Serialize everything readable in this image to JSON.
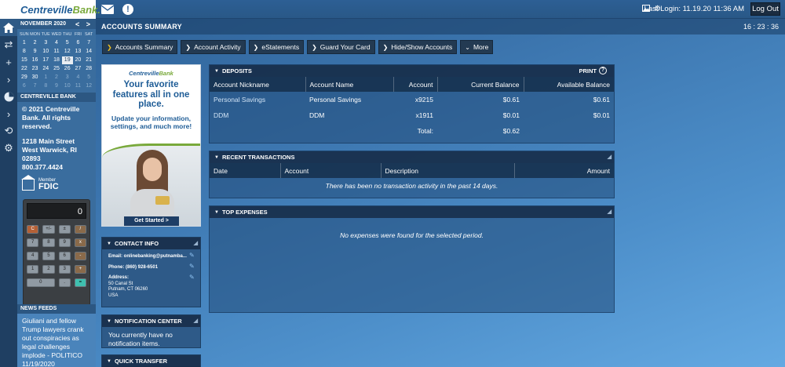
{
  "brand": {
    "name_main": "Centreville",
    "name_accent": "Bank."
  },
  "header": {
    "last_login": "Last Login: 11.19.20 11:36 AM",
    "logout_label": "Log Out",
    "page_title": "ACCOUNTS SUMMARY",
    "clock": "16 : 23 : 36"
  },
  "calendar": {
    "month": "November 2020",
    "arrows": "< >",
    "dow": [
      "SUN",
      "MON",
      "TUE",
      "WED",
      "THU",
      "FRI",
      "SAT"
    ],
    "weeks": [
      [
        "1",
        "2",
        "3",
        "4",
        "5",
        "6",
        "7"
      ],
      [
        "8",
        "9",
        "10",
        "11",
        "12",
        "13",
        "14"
      ],
      [
        "15",
        "16",
        "17",
        "18",
        "19",
        "20",
        "21"
      ],
      [
        "22",
        "23",
        "24",
        "25",
        "26",
        "27",
        "28"
      ],
      [
        "29",
        "30",
        "1",
        "2",
        "3",
        "4",
        "5"
      ],
      [
        "6",
        "7",
        "8",
        "9",
        "10",
        "11",
        "12"
      ]
    ]
  },
  "bank_info": {
    "section_title": "CENTREVILLE BANK",
    "copyright": "© 2021 Centreville Bank. All rights reserved.",
    "address_line1": "1218 Main Street",
    "address_line2": "West Warwick, RI",
    "address_line3": "02893",
    "phone": "800.377.4424",
    "fdic_member": "Member",
    "fdic": "FDIC"
  },
  "calculator": {
    "display": "0",
    "keys": [
      "C",
      "+/-",
      "±",
      "/",
      "7",
      "8",
      "9",
      "x",
      "4",
      "5",
      "6",
      "-",
      "1",
      "2",
      "3",
      "+",
      "0",
      ".",
      "="
    ]
  },
  "news": {
    "title": "NEWS FEEDS",
    "headline": "Giuliani and fellow Trump lawyers crank out conspiracies as legal challenges implode - POLITICO 11/19/2020"
  },
  "nav": [
    "Accounts Summary",
    "Account Activity",
    "eStatements",
    "Guard Your Card",
    "Hide/Show Accounts",
    "More"
  ],
  "ad": {
    "logo_main": "Centreville",
    "logo_accent": "Bank",
    "headline": "Your favorite features all in one place.",
    "sub": "Update your information, settings, and much more!",
    "cta": "Get Started >"
  },
  "deposits": {
    "title": "DEPOSITS",
    "print": "PRINT",
    "columns": [
      "Account Nickname",
      "Account Name",
      "Account",
      "Current Balance",
      "Available Balance"
    ],
    "rows": [
      {
        "nickname": "Personal Savings",
        "name": "Personal Savings",
        "account": "x9215",
        "current": "$0.61",
        "available": "$0.61"
      },
      {
        "nickname": "DDM",
        "name": "DDM",
        "account": "x1911",
        "current": "$0.01",
        "available": "$0.01"
      }
    ],
    "total_label": "Total:",
    "total_value": "$0.62"
  },
  "recent": {
    "title": "RECENT TRANSACTIONS",
    "columns": [
      "Date",
      "Account",
      "Description",
      "Amount"
    ],
    "empty": "There has been no transaction activity in the past 14 days."
  },
  "expenses": {
    "title": "TOP EXPENSES",
    "empty": "No expenses were found for the selected period."
  },
  "contact": {
    "title": "CONTACT INFO",
    "email": "Email: onlinebanking@putnamba...",
    "phone": "Phone: (860) 928-6501",
    "address_label": "Address:",
    "address_line1": "50 Canal St",
    "address_line2": "Putnam, CT 06260",
    "address_line3": "USA"
  },
  "notification": {
    "title": "NOTIFICATION CENTER",
    "body": "You currently have no notification items."
  },
  "quick_transfer": {
    "title": "QUICK TRANSFER"
  }
}
